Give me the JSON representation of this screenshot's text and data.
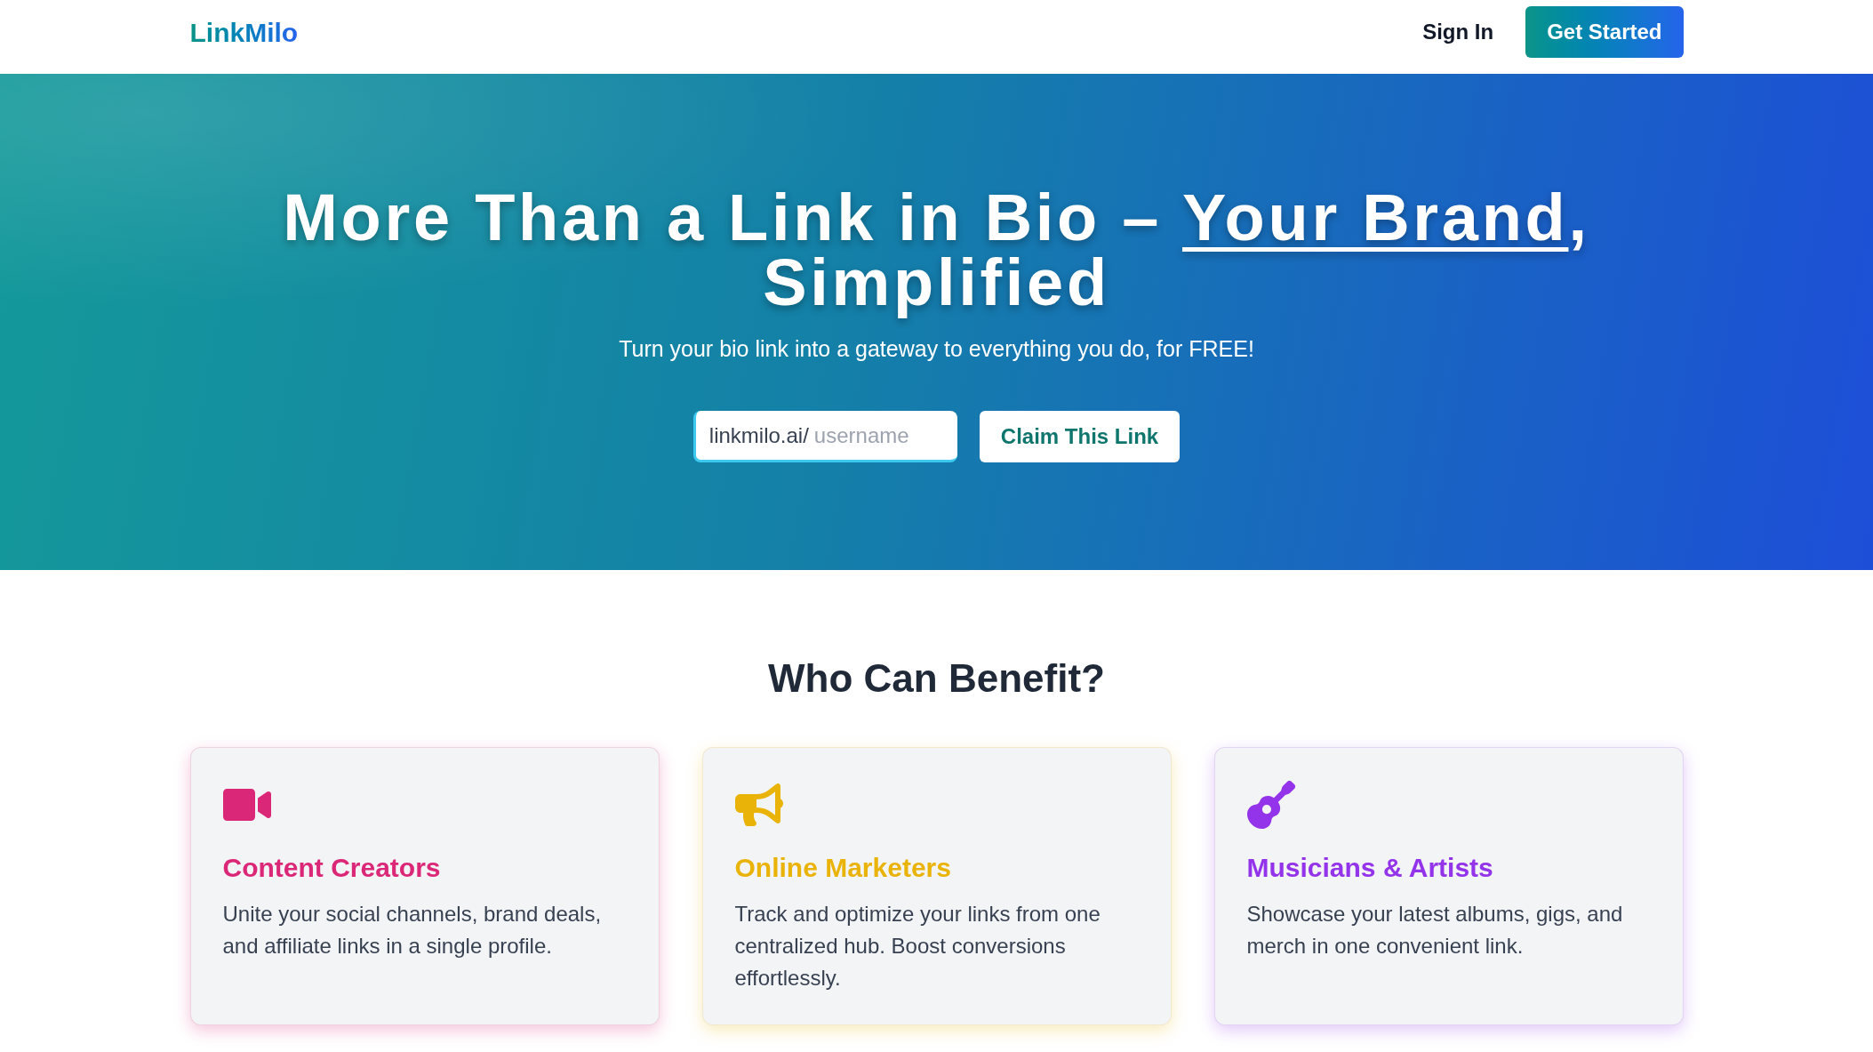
{
  "header": {
    "logo": "LinkMilo",
    "nav": [
      {
        "label": "Sign In",
        "kind": "link"
      },
      {
        "label": "Get Started",
        "kind": "button"
      }
    ]
  },
  "hero": {
    "title": [
      {
        "text": "More Than a Link in Bio – ",
        "underlined": false
      },
      {
        "text": "Your Brand",
        "underlined": true
      },
      {
        "text": ", Simplified",
        "underlined": false
      }
    ],
    "subtitle": "Turn your bio link into a gateway to everything you do, for FREE!",
    "claim_form": {
      "prefix": "linkmilo.ai/",
      "placeholder": "username",
      "button": "Claim This Link"
    }
  },
  "benefits": {
    "heading": "Who Can Benefit?",
    "cards": [
      {
        "title": "Content Creators",
        "text": "Unite your social channels, brand deals, and affiliate links in a single profile.",
        "color": "#db2777"
      },
      {
        "title": "Online Marketers",
        "text": "Track and optimize your links from one centralized hub. Boost conversions effortlessly.",
        "color": "#eab308"
      },
      {
        "title": "Musicians & Artists",
        "text": "Showcase your latest albums, gigs, and merch in one convenient link.",
        "color": "#9333ea"
      }
    ]
  }
}
